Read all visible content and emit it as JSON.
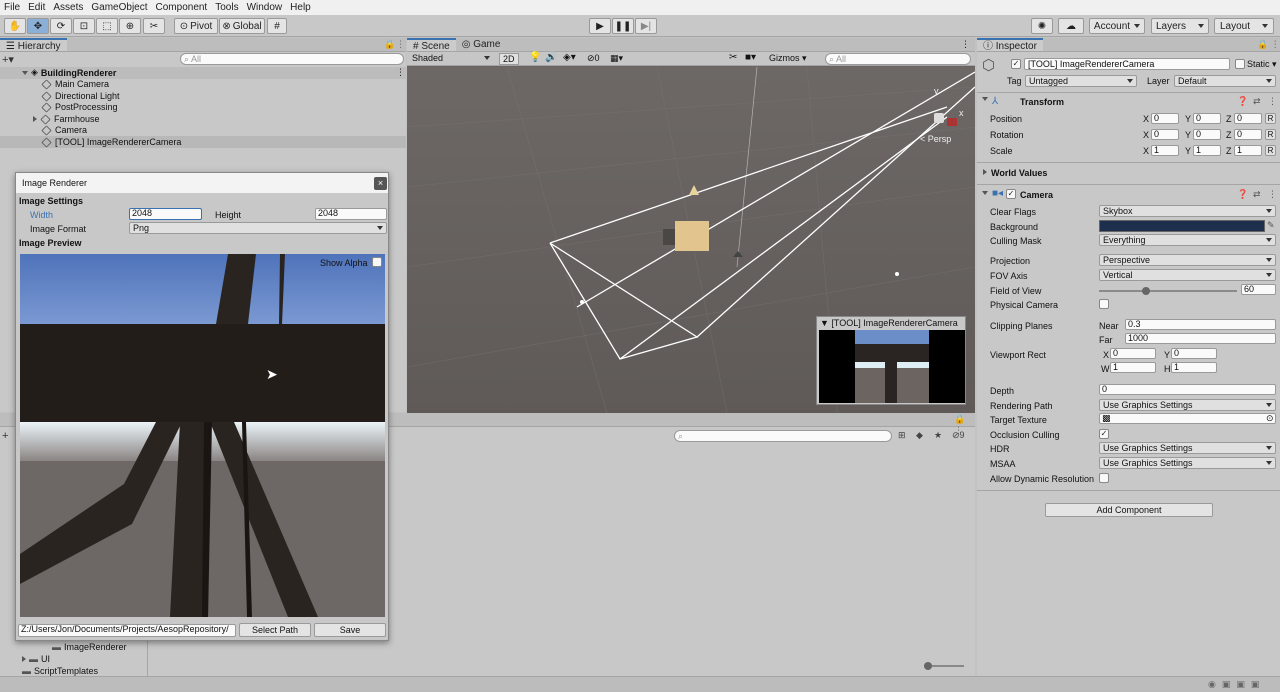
{
  "menubar": {
    "items": [
      "File",
      "Edit",
      "Assets",
      "GameObject",
      "Component",
      "Tools",
      "Window",
      "Help"
    ]
  },
  "toolbar": {
    "pivot": "Pivot",
    "global": "Global",
    "account": "Account",
    "layers": "Layers",
    "layout": "Layout"
  },
  "hierarchy": {
    "tab": "Hierarchy",
    "search_placeholder": "All",
    "root": "BuildingRenderer",
    "items": [
      "Main Camera",
      "Directional Light",
      "PostProcessing",
      "Farmhouse",
      "Camera",
      "[TOOL] ImageRendererCamera"
    ]
  },
  "scene": {
    "tabs": [
      "Scene",
      "Game"
    ],
    "shading": "Shaded",
    "mode2d": "2D",
    "hidden_count": "0",
    "gizmos": "Gizmos",
    "search_placeholder": "All",
    "persp": "< Persp",
    "axis_y": "y",
    "axis_x": "x",
    "preview_title": "[TOOL] ImageRendererCamera"
  },
  "project": {
    "count": "9",
    "folders": [
      "ImageRenderer",
      "UI",
      "ScriptTemplates"
    ]
  },
  "image_renderer": {
    "title": "Image Renderer",
    "settings_header": "Image Settings",
    "width_label": "Width",
    "width_value": "2048",
    "height_label": "Height",
    "height_value": "2048",
    "format_label": "Image Format",
    "format_value": "Png",
    "preview_header": "Image Preview",
    "show_alpha": "Show Alpha",
    "path_value": "Z:/Users/Jon/Documents/Projects/AesopRepository/",
    "select_path": "Select Path",
    "save": "Save"
  },
  "inspector": {
    "tab": "Inspector",
    "object_name": "[TOOL] ImageRendererCamera",
    "static_label": "Static",
    "tag_label": "Tag",
    "tag_value": "Untagged",
    "layer_label": "Layer",
    "layer_value": "Default",
    "transform": {
      "header": "Transform",
      "position_label": "Position",
      "position": [
        "0",
        "0",
        "0"
      ],
      "rotation_label": "Rotation",
      "rotation": [
        "0",
        "0",
        "0"
      ],
      "scale_label": "Scale",
      "scale": [
        "1",
        "1",
        "1"
      ],
      "reset": "R"
    },
    "world_values": "World Values",
    "camera": {
      "header": "Camera",
      "clear_flags_label": "Clear Flags",
      "clear_flags": "Skybox",
      "background_label": "Background",
      "background_color": "#1e2f4d",
      "culling_mask_label": "Culling Mask",
      "culling_mask": "Everything",
      "projection_label": "Projection",
      "projection": "Perspective",
      "fov_axis_label": "FOV Axis",
      "fov_axis": "Vertical",
      "fov_label": "Field of View",
      "fov": "60",
      "fov_fraction": 0.34,
      "physical_label": "Physical Camera",
      "clipping_label": "Clipping Planes",
      "near_label": "Near",
      "near": "0.3",
      "far_label": "Far",
      "far": "1000",
      "viewport_label": "Viewport Rect",
      "vx": "0",
      "vy": "0",
      "vw": "1",
      "vh": "1",
      "depth_label": "Depth",
      "depth": "0",
      "rendering_path_label": "Rendering Path",
      "rendering_path": "Use Graphics Settings",
      "target_texture_label": "Target Texture",
      "occlusion_label": "Occlusion Culling",
      "hdr_label": "HDR",
      "hdr": "Use Graphics Settings",
      "msaa_label": "MSAA",
      "msaa": "Use Graphics Settings",
      "dynamic_res_label": "Allow Dynamic Resolution"
    },
    "add_component": "Add Component"
  }
}
